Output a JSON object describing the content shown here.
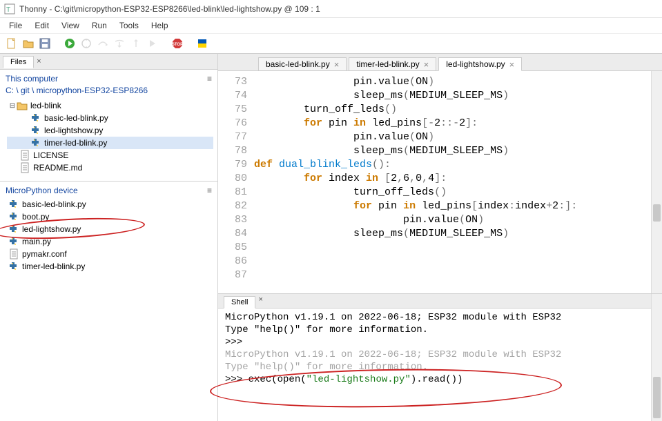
{
  "window": {
    "app_name": "Thonny",
    "title": "Thonny  -  C:\\git\\micropython-ESP32-ESP8266\\led-blink\\led-lightshow.py  @  109 : 1"
  },
  "menu": [
    "File",
    "Edit",
    "View",
    "Run",
    "Tools",
    "Help"
  ],
  "left": {
    "files_tab": "Files",
    "this_computer": "This computer",
    "breadcrumb": "C: \\ git \\ micropython-ESP32-ESP8266",
    "folder": "led-blink",
    "tree": [
      {
        "name": "basic-led-blink.py",
        "type": "py"
      },
      {
        "name": "led-lightshow.py",
        "type": "py"
      },
      {
        "name": "timer-led-blink.py",
        "type": "py",
        "selected": true
      }
    ],
    "siblings": [
      {
        "name": "LICENSE",
        "type": "file"
      },
      {
        "name": "README.md",
        "type": "file"
      }
    ],
    "device_header": "MicroPython device",
    "device_files": [
      {
        "name": "basic-led-blink.py",
        "type": "py"
      },
      {
        "name": "boot.py",
        "type": "py"
      },
      {
        "name": "led-lightshow.py",
        "type": "py",
        "annot": true
      },
      {
        "name": "main.py",
        "type": "py"
      },
      {
        "name": "pymakr.conf",
        "type": "file"
      },
      {
        "name": "timer-led-blink.py",
        "type": "py"
      }
    ]
  },
  "editor": {
    "tabs": [
      {
        "label": "basic-led-blink.py",
        "active": false
      },
      {
        "label": "timer-led-blink.py",
        "active": false
      },
      {
        "label": "led-lightshow.py",
        "active": true
      }
    ],
    "first_line": 73,
    "lines": [
      {
        "indent": 16,
        "tokens": [
          {
            "t": "pin.value"
          },
          {
            "t": "(",
            "c": "br"
          },
          {
            "t": "ON"
          },
          {
            "t": ")",
            "c": "br"
          }
        ]
      },
      {
        "indent": 16,
        "tokens": [
          {
            "t": "sleep_ms"
          },
          {
            "t": "(",
            "c": "br"
          },
          {
            "t": "MEDIUM_SLEEP_MS"
          },
          {
            "t": ")",
            "c": "br"
          }
        ]
      },
      {
        "indent": 0,
        "tokens": []
      },
      {
        "indent": 8,
        "tokens": [
          {
            "t": "turn_off_leds"
          },
          {
            "t": "()",
            "c": "br"
          }
        ]
      },
      {
        "indent": 8,
        "tokens": [
          {
            "t": "for ",
            "c": "kw"
          },
          {
            "t": "pin "
          },
          {
            "t": "in ",
            "c": "kw"
          },
          {
            "t": "led_pins"
          },
          {
            "t": "[-",
            "c": "br"
          },
          {
            "t": "2"
          },
          {
            "t": "::-",
            "c": "br"
          },
          {
            "t": "2"
          },
          {
            "t": "]:",
            "c": "br"
          }
        ]
      },
      {
        "indent": 16,
        "tokens": [
          {
            "t": "pin.value"
          },
          {
            "t": "(",
            "c": "br"
          },
          {
            "t": "ON"
          },
          {
            "t": ")",
            "c": "br"
          }
        ]
      },
      {
        "indent": 16,
        "tokens": [
          {
            "t": "sleep_ms"
          },
          {
            "t": "(",
            "c": "br"
          },
          {
            "t": "MEDIUM_SLEEP_MS"
          },
          {
            "t": ")",
            "c": "br"
          }
        ]
      },
      {
        "indent": 0,
        "tokens": []
      },
      {
        "indent": 0,
        "tokens": [
          {
            "t": "def ",
            "c": "kw"
          },
          {
            "t": "dual_blink_leds",
            "c": "fn"
          },
          {
            "t": "():",
            "c": "br"
          }
        ]
      },
      {
        "indent": 8,
        "tokens": [
          {
            "t": "for ",
            "c": "kw"
          },
          {
            "t": "index "
          },
          {
            "t": "in ",
            "c": "kw"
          },
          {
            "t": "[",
            "c": "br"
          },
          {
            "t": "2"
          },
          {
            "t": ",",
            "c": "br"
          },
          {
            "t": "6"
          },
          {
            "t": ",",
            "c": "br"
          },
          {
            "t": "0"
          },
          {
            "t": ",",
            "c": "br"
          },
          {
            "t": "4"
          },
          {
            "t": "]:",
            "c": "br"
          }
        ]
      },
      {
        "indent": 16,
        "tokens": [
          {
            "t": "turn_off_leds"
          },
          {
            "t": "()",
            "c": "br"
          }
        ]
      },
      {
        "indent": 16,
        "tokens": [
          {
            "t": "for ",
            "c": "kw"
          },
          {
            "t": "pin "
          },
          {
            "t": "in ",
            "c": "kw"
          },
          {
            "t": "led_pins"
          },
          {
            "t": "[",
            "c": "br"
          },
          {
            "t": "index"
          },
          {
            "t": ":",
            "c": "br"
          },
          {
            "t": "index"
          },
          {
            "t": "+",
            "c": "br"
          },
          {
            "t": "2"
          },
          {
            "t": ":]:",
            "c": "br"
          }
        ]
      },
      {
        "indent": 24,
        "tokens": [
          {
            "t": "pin.value"
          },
          {
            "t": "(",
            "c": "br"
          },
          {
            "t": "ON"
          },
          {
            "t": ")",
            "c": "br"
          }
        ]
      },
      {
        "indent": 16,
        "tokens": [
          {
            "t": "sleep_ms"
          },
          {
            "t": "(",
            "c": "br"
          },
          {
            "t": "MEDIUM_SLEEP_MS"
          },
          {
            "t": ")",
            "c": "br"
          }
        ]
      },
      {
        "indent": 0,
        "tokens": []
      }
    ]
  },
  "shell": {
    "tab": "Shell",
    "lines": [
      {
        "text": "MicroPython v1.19.1 on 2022-06-18; ESP32 module with ESP32",
        "c": ""
      },
      {
        "text": "Type \"help()\" for more information.",
        "c": ""
      },
      {
        "text": ">>> ",
        "c": ""
      },
      {
        "text": "MicroPython v1.19.1 on 2022-06-18; ESP32 module with ESP32",
        "c": "gray"
      },
      {
        "text": "Type \"help()\" for more information.",
        "c": "gray"
      }
    ],
    "prompt": ">>> ",
    "cmd_pre": "exec(open(",
    "cmd_str": "\"led-lightshow.py\"",
    "cmd_post": ").read())"
  }
}
